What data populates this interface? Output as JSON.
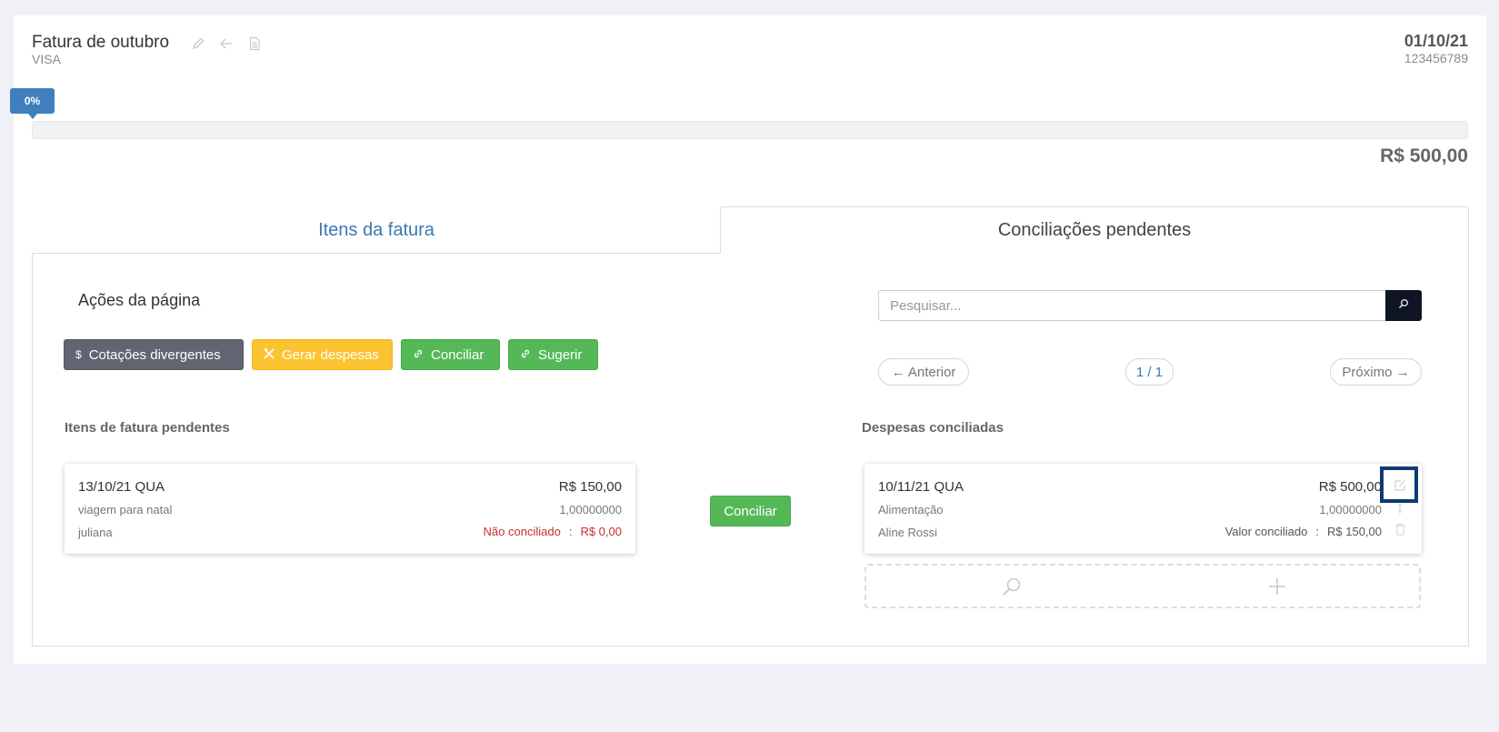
{
  "header": {
    "title": "Fatura de outubro",
    "subtitle": "VISA",
    "date": "01/10/21",
    "number": "123456789",
    "edit_icon": "pencil-icon",
    "back_icon": "arrow-left-icon",
    "doc_icon": "document-icon"
  },
  "progress": {
    "label": "0%",
    "value": 0
  },
  "total": "R$ 500,00",
  "tabs": [
    {
      "label": "Itens da fatura",
      "active": false
    },
    {
      "label": "Conciliações pendentes",
      "active": true
    }
  ],
  "actions": {
    "title": "Ações da página",
    "buttons": [
      {
        "label": "Cotações divergentes",
        "icon": "dollar-icon",
        "color": "#626472"
      },
      {
        "label": "Gerar despesas",
        "icon": "tools-icon",
        "color": "#fcc331"
      },
      {
        "label": "Conciliar",
        "icon": "link-icon",
        "color": "#55b857"
      },
      {
        "label": "Sugerir",
        "icon": "link-icon",
        "color": "#55b857"
      }
    ]
  },
  "search": {
    "placeholder": "Pesquisar...",
    "value": ""
  },
  "pagination": {
    "prev": "← Anterior",
    "page": "1 / 1",
    "next": "Próximo →"
  },
  "pending": {
    "title": "Itens de fatura pendentes",
    "item": {
      "date": "13/10/21 QUA",
      "amount": "R$ 150,00",
      "description": "viagem para natal",
      "rate": "1,00000000",
      "person": "juliana",
      "status_label": "Não conciliado",
      "separator": ":",
      "status_amount": "R$ 0,00"
    }
  },
  "conciliar_button": "Conciliar",
  "reconciled": {
    "title": "Despesas conciliadas",
    "item": {
      "date": "10/11/21 QUA",
      "amount": "R$ 500,00",
      "category": "Alimentação",
      "rate": "1,00000000",
      "person": "Aline Rossi",
      "value_label": "Valor conciliado",
      "separator": ":",
      "value_amount": "R$ 150,00"
    }
  },
  "colors": {
    "primary": "#3f7fc0",
    "danger": "#c9302c",
    "dark": "#0f1524"
  }
}
